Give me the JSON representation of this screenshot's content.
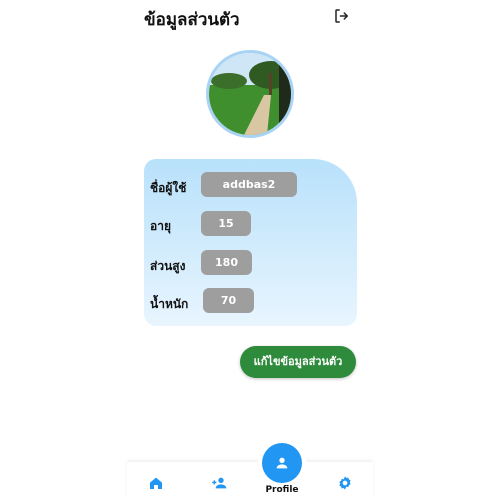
{
  "header": {
    "title": "ข้อมูลส่วนตัว",
    "logout_icon": "logout-icon"
  },
  "profile_card": {
    "fields": [
      {
        "label": "ชื่อผู้ใช้",
        "value": "addbas2"
      },
      {
        "label": "อายุ",
        "value": "15"
      },
      {
        "label": "ส่วนสูง",
        "value": "180"
      },
      {
        "label": "น้ำหนัก",
        "value": "70"
      }
    ]
  },
  "edit_button": {
    "label": "แก้ไขข้อมูลส่วนตัว"
  },
  "bottom_nav": {
    "items": [
      {
        "icon": "home-icon"
      },
      {
        "icon": "add-person-icon"
      },
      {
        "icon": "person-icon",
        "label": "Profile",
        "active": true
      },
      {
        "icon": "gear-icon"
      }
    ]
  },
  "colors": {
    "accent": "#2196f3",
    "edit_button": "#2e8b3c",
    "field_bg": "#9e9e9e",
    "card_gradient_top": "#b8e1fb",
    "card_gradient_bottom": "#e8f5fe"
  }
}
